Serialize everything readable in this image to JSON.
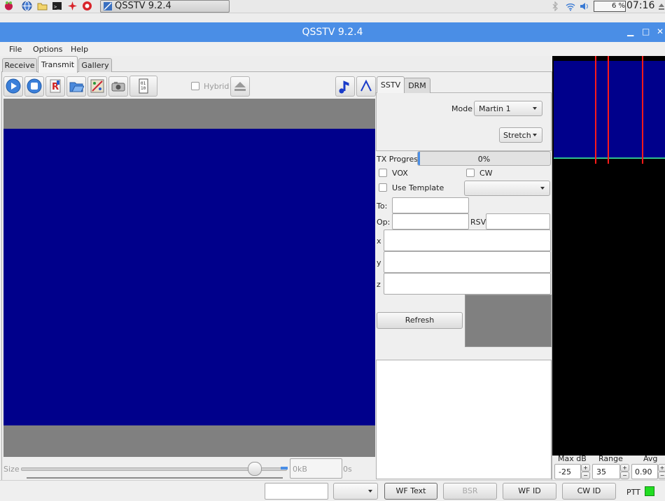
{
  "taskbar": {
    "window_button": "QSSTV 9.2.4",
    "cpu": "6 %",
    "clock": "07:16"
  },
  "window": {
    "title": "QSSTV 9.2.4"
  },
  "menu": {
    "file": "File",
    "options": "Options",
    "help": "Help"
  },
  "tabs": {
    "receive": "Receive",
    "transmit": "Transmit",
    "gallery": "Gallery"
  },
  "toolbar": {
    "hybrid": "Hybrid"
  },
  "size": {
    "label": "Size",
    "kb": "0kB",
    "seconds": "0s",
    "value": 0.9
  },
  "mode_tabs": {
    "sstv": "SSTV",
    "drm": "DRM"
  },
  "sstv": {
    "mode_label": "Mode",
    "mode_value": "Martin 1",
    "stretch_value": "Stretch"
  },
  "tx": {
    "progress_label": "TX Progress",
    "progress_text": "0%",
    "progress_value": 0,
    "vox": "VOX",
    "cw": "CW",
    "use_template": "Use Template",
    "to_label": "To:",
    "op_label": "Op:",
    "rsv_label": "RSV",
    "x_label": "x",
    "y_label": "y",
    "z_label": "z",
    "refresh": "Refresh"
  },
  "spectrum": {
    "maxdb_label": "Max dB",
    "range_label": "Range",
    "avg_label": "Avg",
    "maxdb_value": "-25",
    "range_value": "35",
    "avg_value": "0.90",
    "plus": "+",
    "minus": "−"
  },
  "bottom": {
    "wf_text": "WF Text",
    "bsr": "BSR",
    "wf_id": "WF ID",
    "cw_id": "CW ID",
    "ptt": "PTT"
  },
  "colors": {
    "titlebar": "#4a8ee6",
    "image_blue": "#00008b",
    "ptt_led": "#22dd22"
  }
}
